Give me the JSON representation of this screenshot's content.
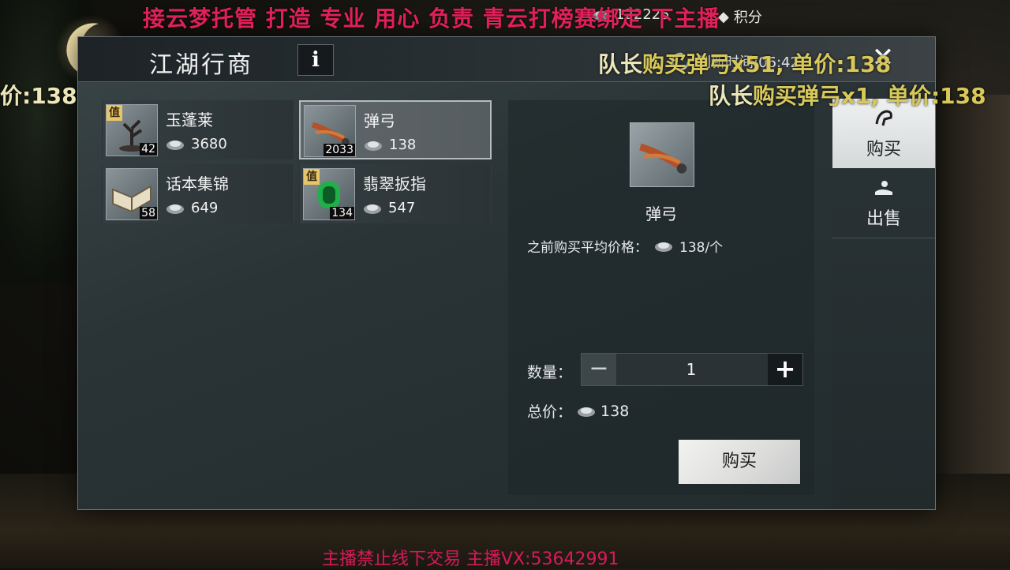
{
  "overlay": {
    "top_banner": "接云梦托管 打造 专业 用心 负责   青云打榜赛绑定 下主播",
    "bottom_banner": "主播禁止线下交易    主播VX:53642991",
    "danmu": [
      {
        "text_pre": "队长",
        "text_hl": "购买弹弓x51, 单价:138"
      },
      {
        "text_pre": "价:138",
        "text_hl": ""
      },
      {
        "text_pre": "队长",
        "text_hl": "购买弹弓x1, 单价:138"
      }
    ]
  },
  "currency": {
    "silver": "122225",
    "points_label": "积分"
  },
  "panel": {
    "title": "江湖行商",
    "info_label": "i",
    "refresh_text": "刷新时间:06:42",
    "close_label": "✕"
  },
  "items": [
    {
      "name": "玉蓬莱",
      "count": "42",
      "price": "3680",
      "tag": "值",
      "selected": false
    },
    {
      "name": "弹弓",
      "count": "2033",
      "price": "138",
      "tag": "",
      "selected": true
    },
    {
      "name": "话本集锦",
      "count": "58",
      "price": "649",
      "tag": "",
      "selected": false
    },
    {
      "name": "翡翠扳指",
      "count": "134",
      "price": "547",
      "tag": "值",
      "selected": false
    }
  ],
  "detail": {
    "name": "弹弓",
    "avg_label": "之前购买平均价格：",
    "avg_value": "138/个",
    "qty_label": "数量：",
    "qty_value": "1",
    "minus": "−",
    "plus": "+",
    "total_label": "总价：",
    "total_value": "138",
    "buy_label": "购买"
  },
  "tabs": {
    "buy": "购买",
    "sell": "出售"
  },
  "colors": {
    "overlay_red": "#e0205a",
    "danmu": "#ece6b8",
    "accent_gold": "#e5c76a"
  }
}
